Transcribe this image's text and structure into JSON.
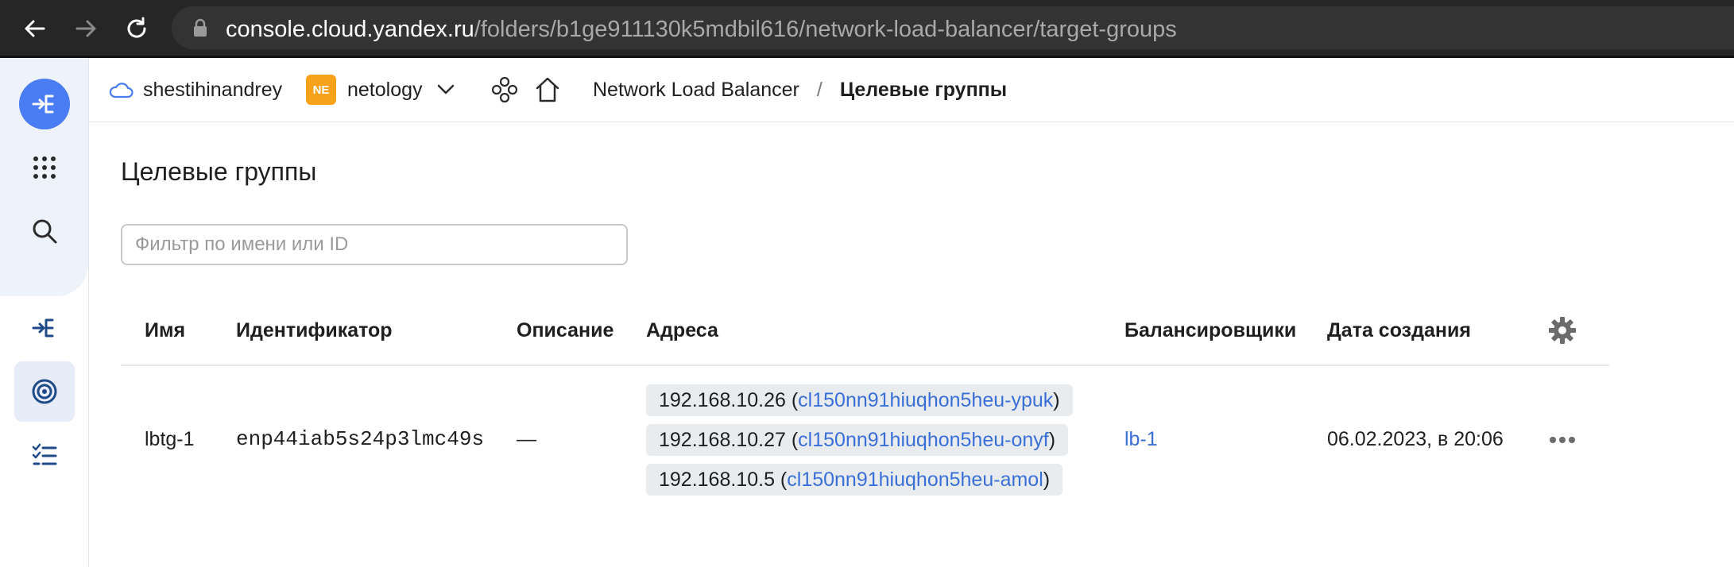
{
  "browser": {
    "url_host": "console.cloud.yandex.ru",
    "url_path": "/folders/b1ge911130k5mdbil616/network-load-balancer/target-groups"
  },
  "header": {
    "cloud_name": "shestihinandrey",
    "org_badge": "NE",
    "folder_name": "netology",
    "breadcrumb_service": "Network Load Balancer",
    "breadcrumb_separator": "/",
    "breadcrumb_current": "Целевые группы"
  },
  "page": {
    "title": "Целевые группы",
    "filter_placeholder": "Фильтр по имени или ID"
  },
  "table": {
    "columns": {
      "name": "Имя",
      "id": "Идентификатор",
      "description": "Описание",
      "addresses": "Адреса",
      "balancers": "Балансировщики",
      "created": "Дата создания"
    },
    "rows": [
      {
        "name": "lbtg-1",
        "id": "enp44iab5s24p3lmc49s",
        "description": "—",
        "addresses": [
          {
            "ip": "192.168.10.26",
            "instance": "cl150nn91hiuqhon5heu-ypuk"
          },
          {
            "ip": "192.168.10.27",
            "instance": "cl150nn91hiuqhon5heu-onyf"
          },
          {
            "ip": "192.168.10.5",
            "instance": "cl150nn91hiuqhon5heu-amol"
          }
        ],
        "balancer": "lb-1",
        "created": "06.02.2023, в 20:06"
      }
    ]
  },
  "punct": {
    "open_paren": " (",
    "close_paren": ")"
  },
  "icons": {
    "back": "arrow-left-icon",
    "forward": "arrow-right-icon",
    "reload": "reload-icon",
    "lock": "lock-icon",
    "cloud": "cloud-icon",
    "chevron": "chevron-down-icon",
    "services": "services-icon",
    "home": "home-icon",
    "settings": "gear-icon",
    "more": "ellipsis-icon"
  },
  "colors": {
    "accent": "#4a7cf4",
    "link": "#3a6fd8",
    "badge": "#f7a21b"
  }
}
